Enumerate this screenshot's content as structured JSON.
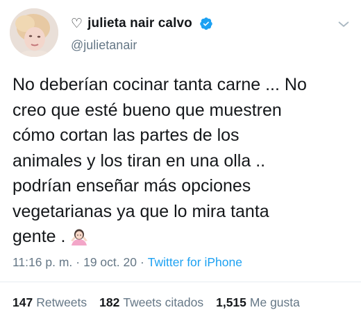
{
  "profile": {
    "heart_icon": "♡",
    "display_name": "julieta nair calvo",
    "handle": "@julietanair",
    "verified": true,
    "verified_color": "#1da1f2"
  },
  "tweet": {
    "text": "No deberían cocinar tanta carne ... No\ncreo que esté bueno que muestren\ncómo cortan las partes de los\nanimales y los tiran en una olla ..\npodrían enseñar más  opciones\nvegetarianas ya que lo mira tanta\ngente .",
    "emoji": "person-shrugging-emoji"
  },
  "meta": {
    "time": "11:16 p. m.",
    "separator": "·",
    "date": "19 oct. 20",
    "source": "Twitter for iPhone"
  },
  "stats": {
    "retweets_count": "147",
    "retweets_label": "Retweets",
    "quotes_count": "182",
    "quotes_label": "Tweets citados",
    "likes_count": "1,515",
    "likes_label": "Me gusta"
  },
  "colors": {
    "link": "#1da1f2",
    "secondary_text": "#657786",
    "primary_text": "#14171a"
  }
}
